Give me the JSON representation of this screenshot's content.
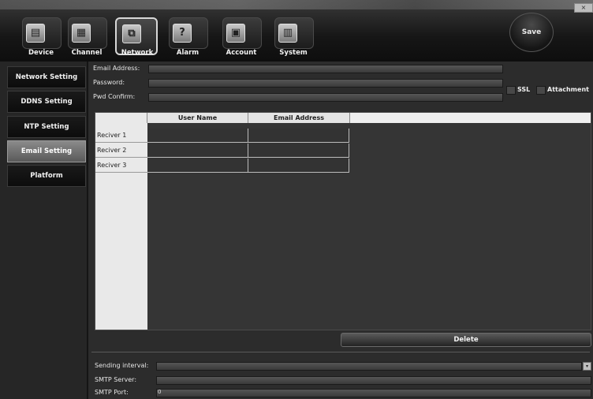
{
  "toolbar": {
    "items": [
      {
        "label": "Device",
        "icon": "device-icon",
        "glyph": "▤"
      },
      {
        "label": "Channel",
        "icon": "channel-icon",
        "glyph": "▦"
      },
      {
        "label": "Network",
        "icon": "network-icon",
        "glyph": "⧉"
      },
      {
        "label": "Alarm",
        "icon": "alarm-icon",
        "glyph": "?"
      },
      {
        "label": "Account",
        "icon": "account-icon",
        "glyph": "▣"
      },
      {
        "label": "System",
        "icon": "system-icon",
        "glyph": "▥"
      }
    ],
    "active_item": "Network",
    "save_label": "Save",
    "close_glyph": "×"
  },
  "sidebar": {
    "items": [
      {
        "label": "Network Setting"
      },
      {
        "label": "DDNS Setting"
      },
      {
        "label": "NTP Setting"
      },
      {
        "label": "Email Setting"
      },
      {
        "label": "Platform"
      }
    ],
    "active_item": "Email Setting"
  },
  "email": {
    "address_label": "Email Address:",
    "password_label": "Password:",
    "confirm_label": "Pwd Confirm:",
    "ssl_label": "SSL",
    "attachment_label": "Attachment"
  },
  "receivers": {
    "columns": [
      "User Name",
      "Email Address"
    ],
    "rows": [
      {
        "label": "Reciver 1",
        "user_name": "",
        "email_address": ""
      },
      {
        "label": "Reciver 2",
        "user_name": "",
        "email_address": ""
      },
      {
        "label": "Reciver 3",
        "user_name": "",
        "email_address": ""
      }
    ]
  },
  "delete_label": "Delete",
  "smtp": {
    "sending_interval_label": "Sending interval:",
    "server_label": "SMTP Server:",
    "port_label": "SMTP Port:",
    "port_value": "0",
    "dropdown_glyph": "▾"
  },
  "colors": {
    "active_sidebar": "#7a7a7a",
    "background": "#2c2c2c",
    "table_header": "#e9e9e9"
  }
}
